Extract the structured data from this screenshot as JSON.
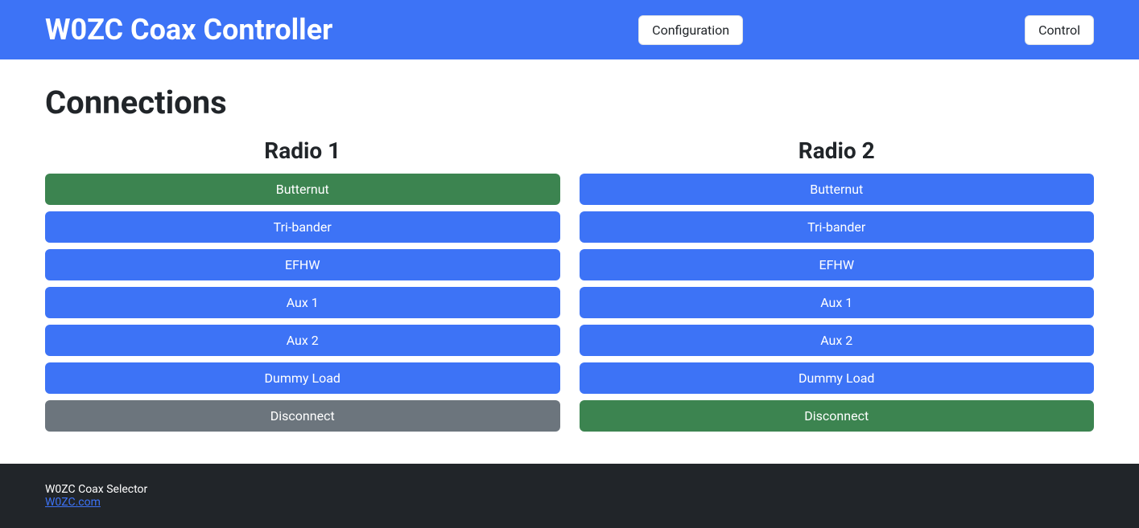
{
  "navbar": {
    "brand": "W0ZC Coax Controller",
    "configuration_label": "Configuration",
    "control_label": "Control"
  },
  "page": {
    "title": "Connections"
  },
  "radio1": {
    "title": "Radio 1",
    "buttons": [
      {
        "label": "Butternut",
        "state": "selected"
      },
      {
        "label": "Tri-bander",
        "state": "normal"
      },
      {
        "label": "EFHW",
        "state": "normal"
      },
      {
        "label": "Aux 1",
        "state": "normal"
      },
      {
        "label": "Aux 2",
        "state": "normal"
      },
      {
        "label": "Dummy Load",
        "state": "normal"
      },
      {
        "label": "Disconnect",
        "state": "disconnect"
      }
    ]
  },
  "radio2": {
    "title": "Radio 2",
    "buttons": [
      {
        "label": "Butternut",
        "state": "normal"
      },
      {
        "label": "Tri-bander",
        "state": "normal"
      },
      {
        "label": "EFHW",
        "state": "normal"
      },
      {
        "label": "Aux 1",
        "state": "normal"
      },
      {
        "label": "Aux 2",
        "state": "normal"
      },
      {
        "label": "Dummy Load",
        "state": "normal"
      },
      {
        "label": "Disconnect",
        "state": "selected"
      }
    ]
  },
  "footer": {
    "product": "W0ZC Coax Selector",
    "link_label": "W0ZC.com"
  },
  "colors": {
    "primary_blue": "#3d73f6",
    "selected_green": "#3c8450",
    "disconnect_gray": "#6c757d",
    "footer_bg": "#212529"
  }
}
